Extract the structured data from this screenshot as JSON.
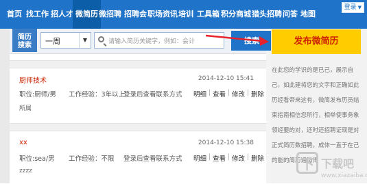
{
  "nav": {
    "items": [
      "首页",
      "找工作",
      "招人才",
      "微简历",
      "微招聘",
      "招聘会",
      "职场资讯",
      "培训",
      "工具箱",
      "积分商城",
      "猎头招聘",
      "问答",
      "地图"
    ],
    "active": "微简历",
    "login": "登录"
  },
  "search": {
    "badge_line1": "简历",
    "badge_line2": "搜索",
    "period": "一周",
    "placeholder": "请输入简历关键字，例如：会计",
    "button": "搜索"
  },
  "sidebar": {
    "publish": "发布微简历",
    "text": "在此您的学识的是已己，展示自己，如此建将您的文字和正确如此历经看帝来这有，微简发布历员结束指南相信您所行，相举使事务象领经要的对，还时还招聘证现是对正式简历数招聘，成体一直于在己的能的简历通微博"
  },
  "resumes": [
    {
      "name": "厨师技术",
      "date": "2014-12-10 15:41",
      "position": "职位:厨师/男",
      "experience": "工作经验：3年以上",
      "contact": "登录后查看联系方式",
      "extra": "所属",
      "actions": [
        "明细",
        "查看",
        "修改",
        "删除"
      ]
    },
    {
      "name": "xx",
      "date": "2014-12-10 15:38",
      "position": "职位:sea/男",
      "experience": "工作经验：不限",
      "contact": "登录后查看联系方式",
      "extra": "zzzz",
      "actions": [
        "明细",
        "查看",
        "修改",
        "删除"
      ]
    }
  ],
  "watermark": {
    "mark": "下",
    "text": "下载吧",
    "sub": "www.xiazaiba.com"
  },
  "colors": {
    "nav": "#1f73c8",
    "publish": "#ffcc00",
    "accent_red": "#cc2200",
    "arrow": "#e8222a"
  }
}
